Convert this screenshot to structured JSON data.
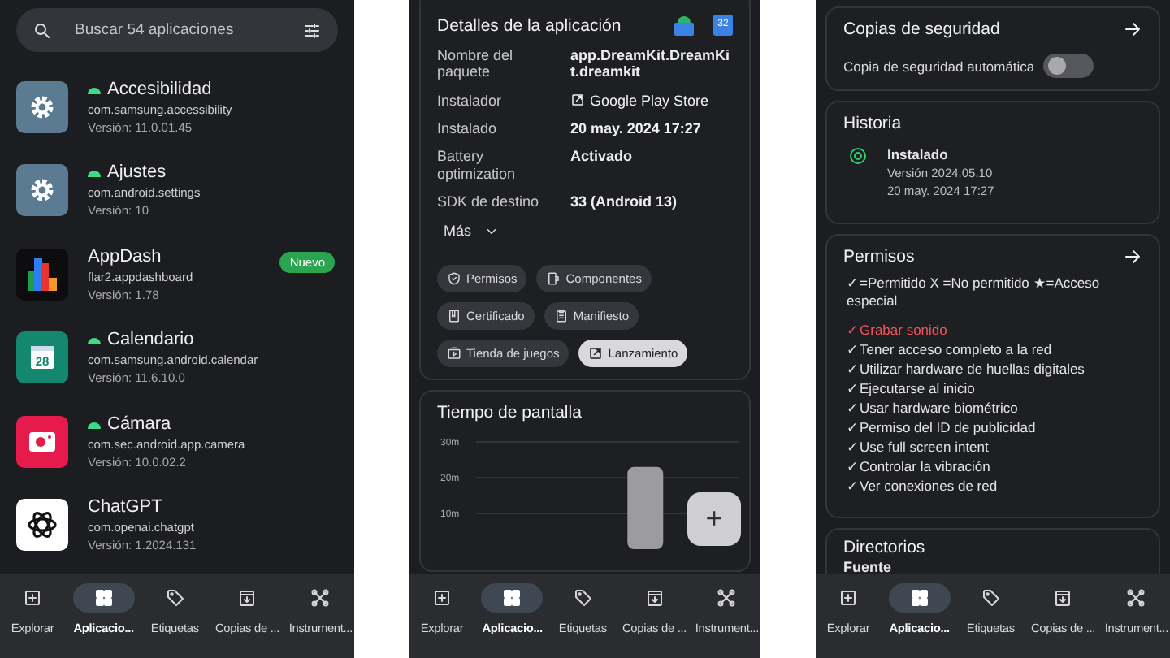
{
  "app_list": {
    "search": {
      "placeholder": "Buscar 54 aplicaciones"
    },
    "apps": [
      {
        "name": "Accesibilidad",
        "package": "com.samsung.accessibility",
        "version": "Versión: 11.0.01.45",
        "system": true,
        "kind": "gear",
        "color": "#5b7b93"
      },
      {
        "name": "Ajustes",
        "package": "com.android.settings",
        "version": "Versión: 10",
        "system": true,
        "kind": "gear",
        "color": "#5b7b93"
      },
      {
        "name": "AppDash",
        "package": "flar2.appdashboard",
        "version": "Versión: 1.78",
        "system": false,
        "kind": "bars",
        "color": "#0d0d0f",
        "badge": "Nuevo"
      },
      {
        "name": "Calendario",
        "package": "com.samsung.android.calendar",
        "version": "Versión: 11.6.10.0",
        "system": true,
        "kind": "calendar",
        "color": "#14886f",
        "icon_text": "28"
      },
      {
        "name": "Cámara",
        "package": "com.sec.android.app.camera",
        "version": "Versión: 10.0.02.2",
        "system": true,
        "kind": "camera",
        "color": "#e61a4b"
      },
      {
        "name": "ChatGPT",
        "package": "com.openai.chatgpt",
        "version": "Versión: 1.2024.131",
        "system": false,
        "kind": "knot",
        "color": "#ffffff"
      }
    ],
    "nav": [
      {
        "label": "Explorar",
        "kind": "plus",
        "selected": false
      },
      {
        "label": "Aplicacio...",
        "kind": "grid",
        "selected": true
      },
      {
        "label": "Etiquetas",
        "kind": "tag",
        "selected": false
      },
      {
        "label": "Copias de ...",
        "kind": "archive",
        "selected": false
      },
      {
        "label": "Instrument...",
        "kind": "tools",
        "selected": false
      }
    ]
  },
  "app_details": {
    "title": "Detalles de la aplicación",
    "bit_badge": "32",
    "fields": [
      {
        "label": "Nombre del paquete",
        "value": "app.DreamKit.DreamKit.dreamkit",
        "kind": "text"
      },
      {
        "label": "Instalador",
        "value": "Google Play Store",
        "kind": "link"
      },
      {
        "label": "Instalado",
        "value": "20 may. 2024 17:27",
        "kind": "text"
      },
      {
        "label": "Battery optimization",
        "value": "Activado",
        "kind": "text"
      },
      {
        "label": "SDK de destino",
        "value": "33 (Android 13)",
        "kind": "text"
      }
    ],
    "more": "Más",
    "chips": [
      {
        "label": "Permisos",
        "kind": "shield",
        "selected": false
      },
      {
        "label": "Componentes",
        "kind": "component",
        "selected": false
      },
      {
        "label": "Certificado",
        "kind": "cert",
        "selected": false
      },
      {
        "label": "Manifiesto",
        "kind": "clipboard",
        "selected": false
      },
      {
        "label": "Tienda de juegos",
        "kind": "play",
        "selected": false
      },
      {
        "label": "Lanzamiento",
        "kind": "launch",
        "selected": true
      }
    ],
    "screen_time": {
      "title": "Tiempo de pantalla",
      "chart_data": {
        "type": "bar",
        "values": [
          null,
          null,
          null,
          null,
          23,
          null,
          null
        ],
        "ylim": [
          0,
          30
        ],
        "yticks": [
          {
            "value": 10,
            "label": "10m"
          },
          {
            "value": 20,
            "label": "20m"
          },
          {
            "value": 30,
            "label": "30m"
          }
        ]
      }
    },
    "fab": "+",
    "nav": [
      {
        "label": "Explorar",
        "kind": "plus",
        "selected": false
      },
      {
        "label": "Aplicacio...",
        "kind": "grid",
        "selected": true
      },
      {
        "label": "Etiquetas",
        "kind": "tag",
        "selected": false
      },
      {
        "label": "Copias de ...",
        "kind": "archive",
        "selected": false
      },
      {
        "label": "Instrument...",
        "kind": "tools",
        "selected": false
      }
    ]
  },
  "app_info": {
    "backup": {
      "title": "Copias de seguridad",
      "toggle_label": "Copia de seguridad automática",
      "on": false
    },
    "history": {
      "title": "Historia",
      "entries": [
        {
          "event": "Instalado",
          "version": "Versión 2024.05.10",
          "date": "20 may. 2024 17:27"
        }
      ]
    },
    "permissions": {
      "title": "Permisos",
      "legend": "✓=Permitido  X =No permitido  ★=Acceso especial",
      "items": [
        {
          "mark": "✓",
          "label": "Grabar sonido",
          "dangerous": true
        },
        {
          "mark": "✓",
          "label": "Tener acceso completo a la red",
          "dangerous": false
        },
        {
          "mark": "✓",
          "label": "Utilizar hardware de huellas digitales",
          "dangerous": false
        },
        {
          "mark": "✓",
          "label": "Ejecutarse al inicio",
          "dangerous": false
        },
        {
          "mark": "✓",
          "label": "Usar hardware biométrico",
          "dangerous": false
        },
        {
          "mark": "✓",
          "label": "Permiso del ID de publicidad",
          "dangerous": false
        },
        {
          "mark": "✓",
          "label": "Use full screen intent",
          "dangerous": false
        },
        {
          "mark": "✓",
          "label": "Controlar la vibración",
          "dangerous": false
        },
        {
          "mark": "✓",
          "label": "Ver conexiones de red",
          "dangerous": false
        }
      ]
    },
    "directories": {
      "title": "Directorios",
      "first": "Fuente"
    },
    "nav": [
      {
        "label": "Explorar",
        "kind": "plus",
        "selected": false
      },
      {
        "label": "Aplicacio...",
        "kind": "grid",
        "selected": true
      },
      {
        "label": "Etiquetas",
        "kind": "tag",
        "selected": false
      },
      {
        "label": "Copias de ...",
        "kind": "archive",
        "selected": false
      },
      {
        "label": "Instrument...",
        "kind": "tools",
        "selected": false
      }
    ]
  }
}
